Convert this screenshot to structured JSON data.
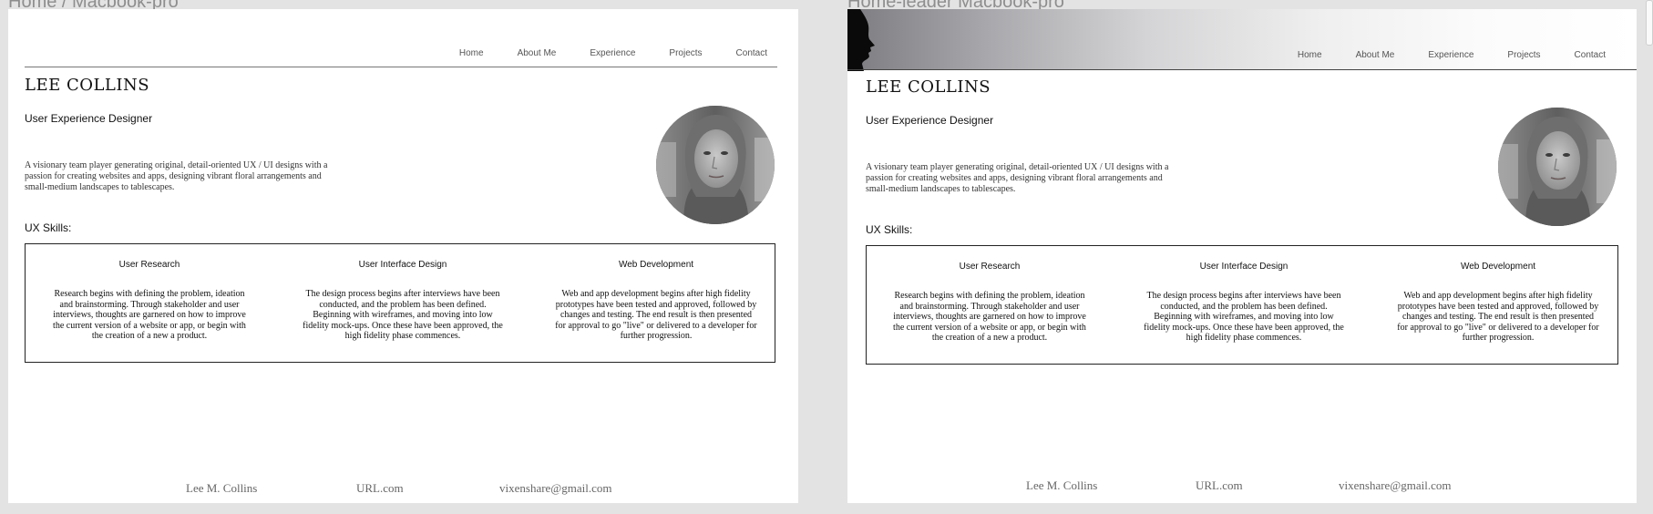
{
  "frames": [
    {
      "label": "Home / Macbook-pro",
      "nav": [
        "Home",
        "About Me",
        "Experience",
        "Projects",
        "Contact"
      ],
      "name": "LEE COLLINS",
      "role": "User Experience Designer",
      "intro": "A visionary team player generating original, detail-oriented UX / UI designs with a passion for creating websites and apps, designing vibrant floral arrangements and small-medium landscapes to tablescapes.",
      "skills_heading": "UX Skills:",
      "skills": [
        {
          "title": "User Research",
          "body": "Research begins with defining the problem, ideation and brainstorming. Through stakeholder and user interviews, thoughts are garnered on how to improve the current version of a website or app, or begin with the creation of a new a product."
        },
        {
          "title": "User Interface Design",
          "body": "The design process begins after interviews have been conducted, and the problem has been defined. Beginning with wireframes, and moving into low fidelity mock-ups. Once these have been approved, the high fidelity phase commences."
        },
        {
          "title": "Web Development",
          "body": "Web and app development begins after high fidelity prototypes have been tested and approved, followed by changes and testing. The end result is then presented for approval to go \"live\" or delivered to a developer for further progression."
        }
      ],
      "footer": [
        "Lee M. Collins",
        "URL.com",
        "vixenshare@gmail.com"
      ]
    },
    {
      "label": "Home-leader Macbook-pro",
      "nav": [
        "Home",
        "About Me",
        "Experience",
        "Projects",
        "Contact"
      ],
      "name": "LEE COLLINS",
      "role": "User Experience Designer",
      "intro": "A visionary team player generating original, detail-oriented UX / UI designs with a passion for creating websites and apps, designing vibrant floral arrangements and small-medium landscapes to tablescapes.",
      "skills_heading": "UX Skills:",
      "skills": [
        {
          "title": "User Research",
          "body": "Research begins with defining the problem, ideation and brainstorming. Through stakeholder and user interviews, thoughts are garnered on how to improve the current version of a website or app, or begin with the creation of a new a product."
        },
        {
          "title": "User Interface Design",
          "body": "The design process begins after interviews have been conducted, and the problem has been defined. Beginning with wireframes, and moving into low fidelity mock-ups. Once these have been approved, the high fidelity phase commences."
        },
        {
          "title": "Web Development",
          "body": "Web and app development begins after high fidelity prototypes have been tested and approved, followed by changes and testing. The end result is then presented for approval to go \"live\" or delivered to a developer for further progression."
        }
      ],
      "footer": [
        "Lee M. Collins",
        "URL.com",
        "vixenshare@gmail.com"
      ]
    }
  ],
  "colors": {
    "canvas": "#e3e3e3",
    "artboard": "#ffffff",
    "rule": "#777777",
    "footer_text": "#666666"
  },
  "icons": {
    "header_decoration": "face-silhouette-icon",
    "portrait": "profile-photo"
  }
}
